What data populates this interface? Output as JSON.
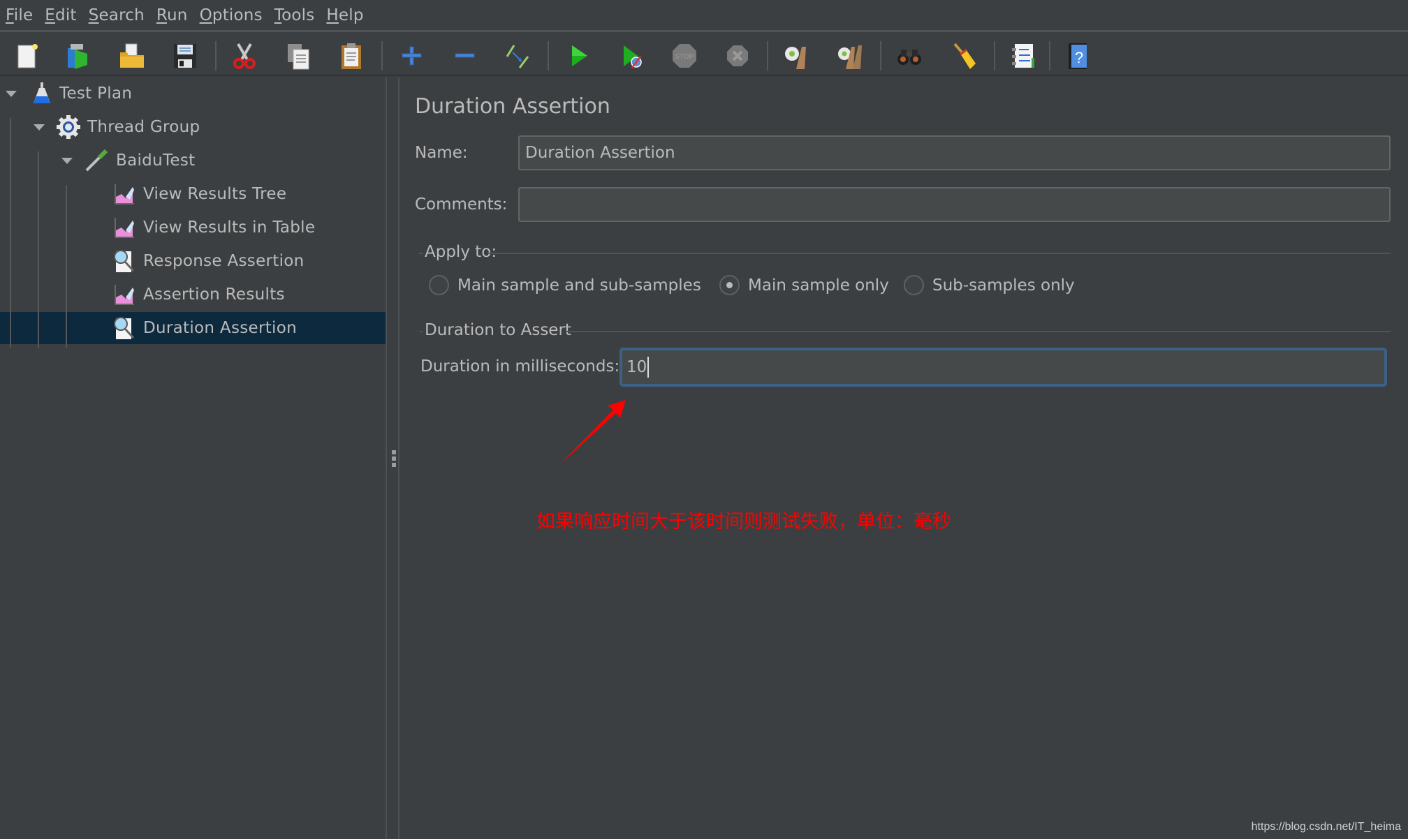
{
  "menu": [
    {
      "label": "File",
      "mnemonic": "F",
      "rest": "ile"
    },
    {
      "label": "Edit",
      "mnemonic": "E",
      "rest": "dit"
    },
    {
      "label": "Search",
      "mnemonic": "S",
      "rest": "earch"
    },
    {
      "label": "Run",
      "mnemonic": "R",
      "rest": "un"
    },
    {
      "label": "Options",
      "mnemonic": "O",
      "rest": "ptions"
    },
    {
      "label": "Tools",
      "mnemonic": "T",
      "rest": "ools"
    },
    {
      "label": "Help",
      "mnemonic": "H",
      "rest": "elp"
    }
  ],
  "toolbar": {
    "buttons": [
      {
        "name": "new",
        "icon": "new-document-icon"
      },
      {
        "name": "templates",
        "icon": "templates-icon"
      },
      {
        "name": "open",
        "icon": "open-folder-icon"
      },
      {
        "name": "save",
        "icon": "save-disk-icon"
      },
      {
        "name": "cut",
        "icon": "scissors-icon"
      },
      {
        "name": "copy",
        "icon": "copy-icon"
      },
      {
        "name": "paste",
        "icon": "paste-clipboard-icon"
      },
      {
        "name": "expand-all",
        "icon": "plus-icon"
      },
      {
        "name": "collapse-all",
        "icon": "minus-icon"
      },
      {
        "name": "toggle",
        "icon": "toggle-wand-icon"
      },
      {
        "name": "start",
        "icon": "play-icon"
      },
      {
        "name": "start-no-pauses",
        "icon": "play-no-timers-icon"
      },
      {
        "name": "stop",
        "icon": "stop-icon"
      },
      {
        "name": "shutdown",
        "icon": "shutdown-icon"
      },
      {
        "name": "clear",
        "icon": "clear-broom-gear-icon"
      },
      {
        "name": "clear-all",
        "icon": "clear-all-brooms-gear-icon"
      },
      {
        "name": "search",
        "icon": "binoculars-icon"
      },
      {
        "name": "reset-search",
        "icon": "broom-icon"
      },
      {
        "name": "function-helper",
        "icon": "function-list-icon"
      },
      {
        "name": "help",
        "icon": "help-book-icon"
      }
    ]
  },
  "tree": {
    "items": [
      {
        "label": "Test Plan",
        "icon": "test-plan-flask-icon",
        "expanded": true,
        "level": 0
      },
      {
        "label": "Thread Group",
        "icon": "thread-group-gear-icon",
        "expanded": true,
        "level": 1
      },
      {
        "label": "BaiduTest",
        "icon": "sampler-pipette-icon",
        "expanded": true,
        "level": 2
      },
      {
        "label": "View Results Tree",
        "icon": "listener-chart-icon",
        "level": 3
      },
      {
        "label": "View Results in Table",
        "icon": "listener-chart-icon",
        "level": 3
      },
      {
        "label": "Response Assertion",
        "icon": "assertion-magnifier-icon",
        "level": 3
      },
      {
        "label": "Assertion Results",
        "icon": "listener-chart-icon",
        "level": 3
      },
      {
        "label": "Duration Assertion",
        "icon": "assertion-magnifier-icon",
        "level": 3,
        "selected": true
      }
    ]
  },
  "panel": {
    "title": "Duration Assertion",
    "name_label": "Name:",
    "name_value": "Duration Assertion",
    "comments_label": "Comments:",
    "comments_value": "",
    "apply_to": {
      "title": "Apply to:",
      "options": [
        {
          "label": "Main sample and sub-samples",
          "checked": false
        },
        {
          "label": "Main sample only",
          "checked": true
        },
        {
          "label": "Sub-samples only",
          "checked": false
        }
      ]
    },
    "duration_group": {
      "title": "Duration to Assert",
      "label": "Duration in milliseconds:",
      "value": "10"
    }
  },
  "annotation": {
    "text": "如果响应时间大于该时间则测试失败，单位：毫秒",
    "color": "#ff0000"
  },
  "watermark": "https://blog.csdn.net/IT_heima",
  "colors": {
    "background": "#3c3f41",
    "selection": "#0d293e",
    "focus_border": "#3d6185",
    "text": "#bbbbbb"
  }
}
